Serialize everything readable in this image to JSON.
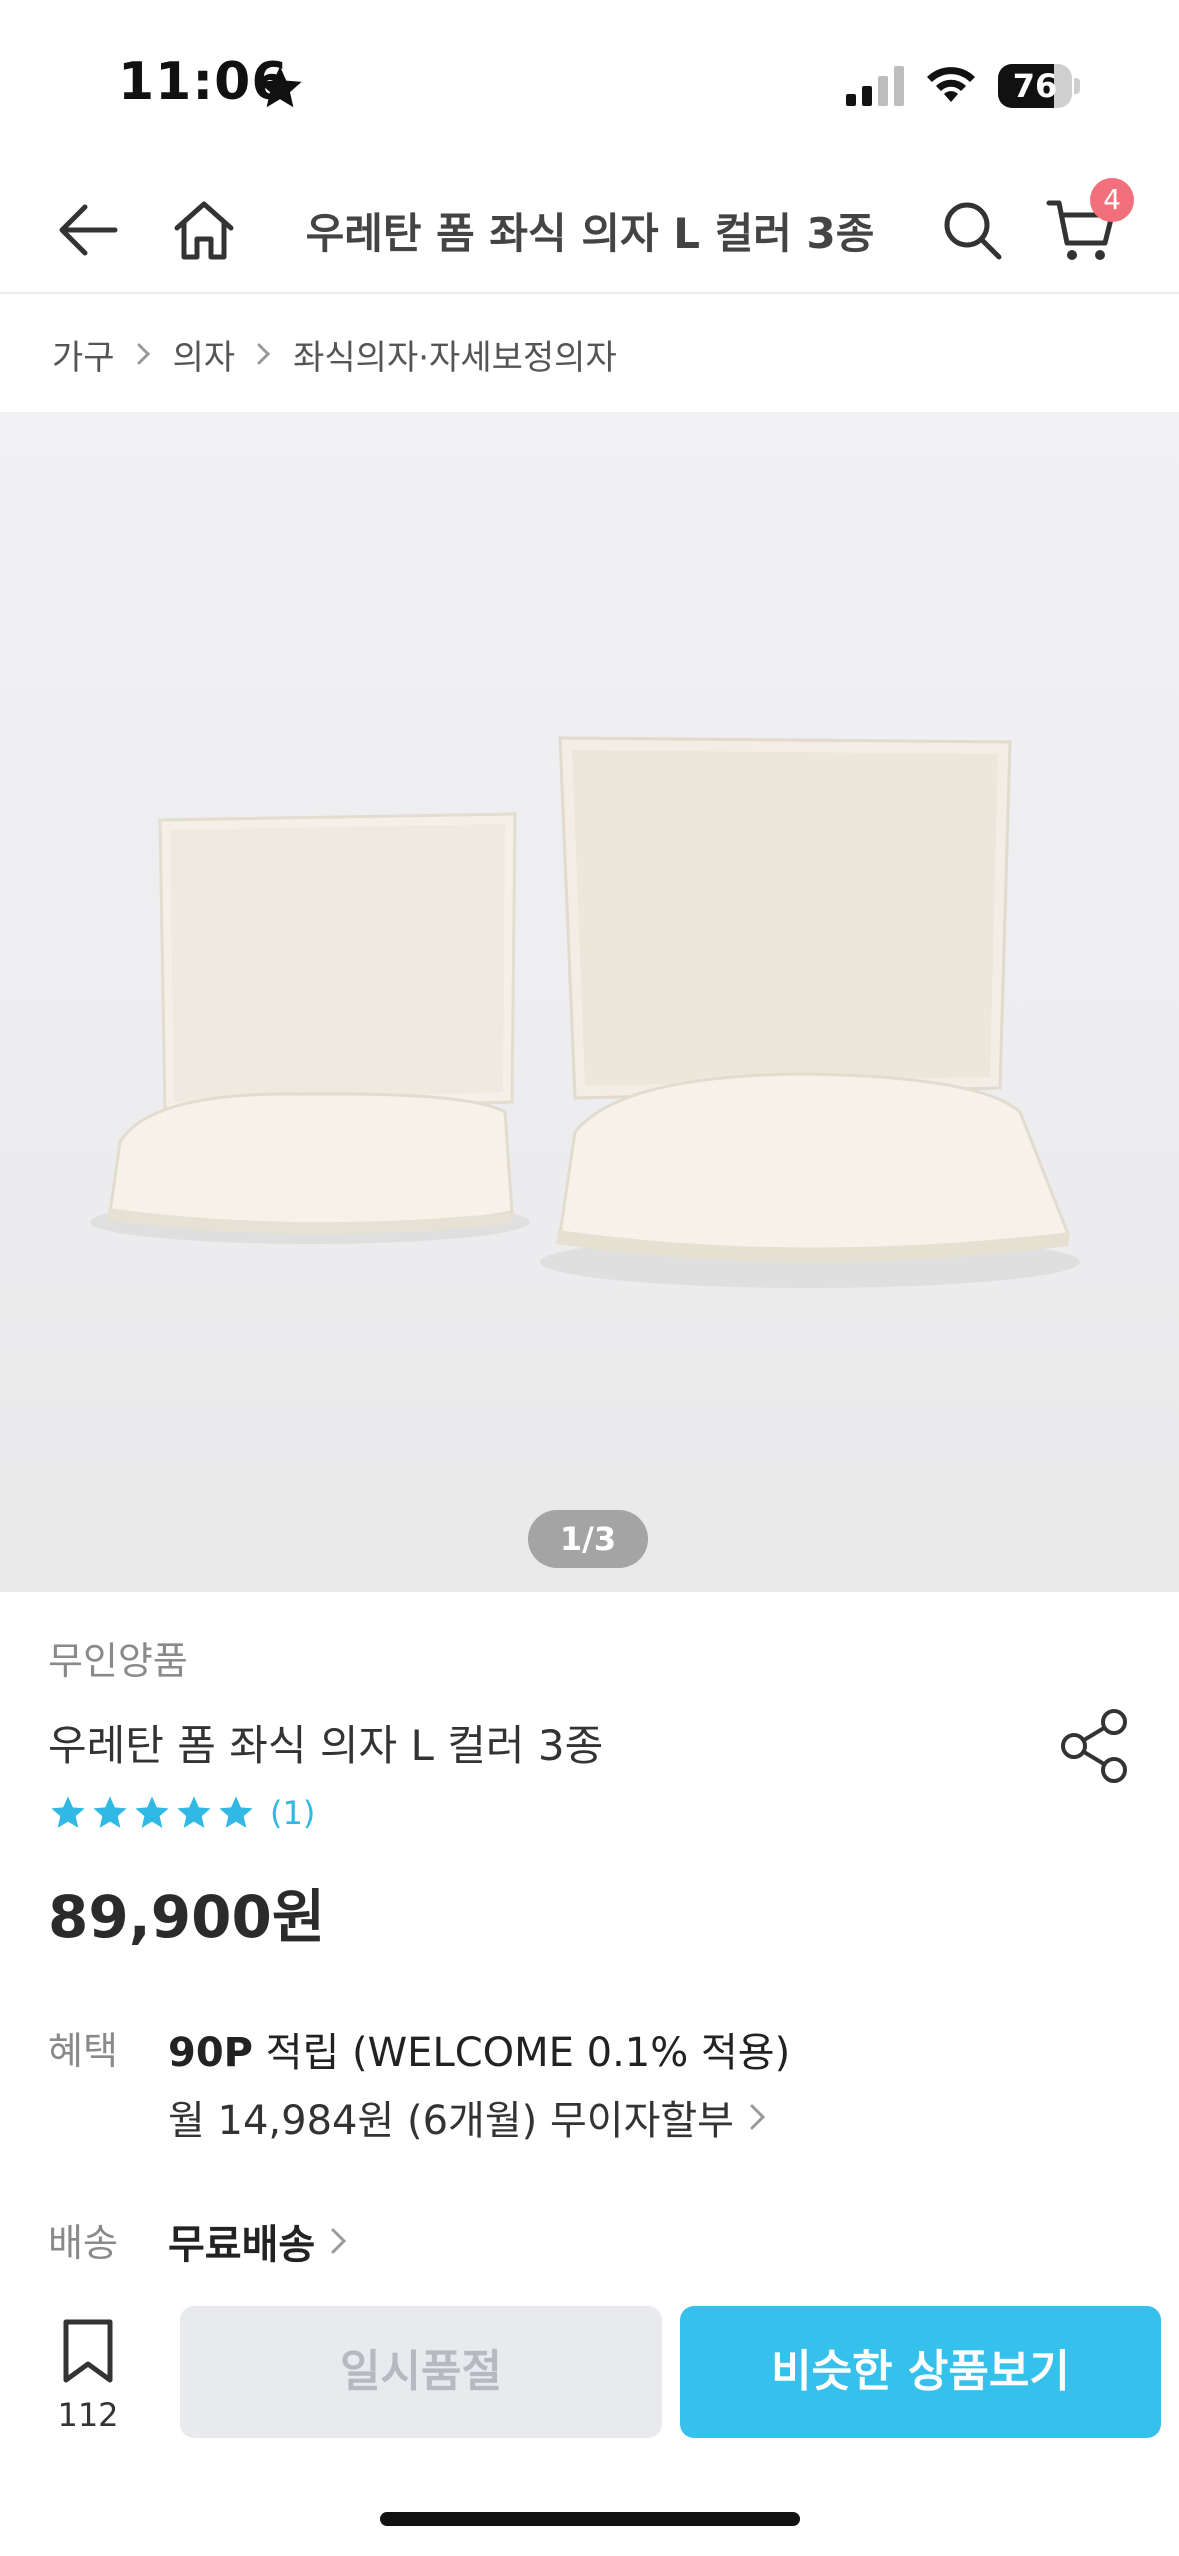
{
  "status_bar": {
    "time": "11:06",
    "battery_level": "76",
    "battery_fraction": 0.76
  },
  "header": {
    "title": "우레탄 폼 좌식 의자 L 컬러 3종",
    "cart_count": "4"
  },
  "breadcrumb": [
    "가구",
    "의자",
    "좌식의자·자세보정의자"
  ],
  "gallery": {
    "pager": "1/3"
  },
  "product": {
    "brand": "무인양품",
    "name": "우레탄 폼 좌식 의자 L 컬러 3종",
    "rating_stars": 5,
    "review_count": "(1)",
    "price": "89,900원"
  },
  "benefit": {
    "label": "혜택",
    "points": "90P",
    "points_text": " 적립 (WELCOME 0.1% 적용)",
    "installment": "월 14,984원 (6개월) 무이자할부"
  },
  "shipping": {
    "label": "배송",
    "value": "무료배송"
  },
  "bottom_bar": {
    "wish_count": "112",
    "soldout_label": "일시품절",
    "similar_label": "비슷한 상품보기"
  },
  "colors": {
    "accent": "#36c1ec",
    "badge": "#f2707b",
    "star": "#2fb9e4"
  }
}
